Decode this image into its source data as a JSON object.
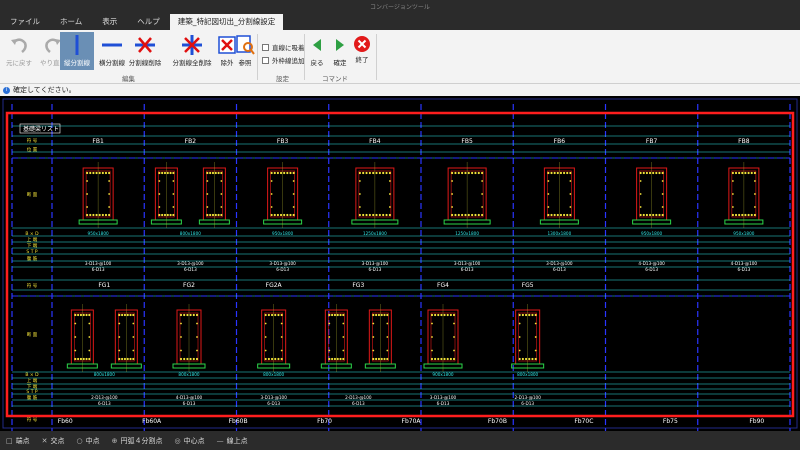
{
  "window": {
    "app_title": "コンバージョンツール"
  },
  "menu": {
    "tabs": [
      "ファイル",
      "ホーム",
      "表示",
      "ヘルプ",
      "建築_特記図切出_分割線設定"
    ]
  },
  "ribbon": {
    "undo": "元に戻す",
    "redo": "やり直し",
    "vert_split": "縦分割線",
    "horz_split": "横分割線",
    "delete_split": "分割線削除",
    "delete_all_split": "分割線全削除",
    "exclude": "除外",
    "reference": "参照",
    "group_edit": "編集",
    "opt_snap": "直線に吸着",
    "opt_add_frame": "外枠線追加",
    "group_settings": "設定",
    "back": "戻る",
    "confirm": "確定",
    "finish": "終了",
    "group_command": "コマンド"
  },
  "message": "確定してください。",
  "drawing": {
    "title_tag": "基礎梁リスト",
    "row1_labels": [
      "FB1",
      "FB2",
      "FB3",
      "FB4",
      "FB5",
      "FB6",
      "FB7",
      "FB8"
    ],
    "row2_labels": [
      "FG1",
      "FG2",
      "FG2A",
      "FG3",
      "FG4",
      "FG5"
    ],
    "bottom_labels": [
      "Fb60",
      "Fb60A",
      "Fb60B",
      "Fb70",
      "Fb70A",
      "Fb70B",
      "Fb70C",
      "Fb75",
      "Fb90"
    ],
    "sizes_row1": [
      "950x1800",
      "800x1800",
      "950x1800",
      "1250x1800",
      "1250x1800",
      "1300x1800",
      "950x1800",
      "950x1800"
    ],
    "sizes_row2": [
      "800x1800",
      "800x1800",
      "800x1800",
      "",
      "900x1800",
      "800x1800"
    ],
    "stirrup_row1": [
      "3-D13-@100",
      "3-D13-@100",
      "3-D13-@100",
      "3-D13-@100",
      "3-D13-@100",
      "3-D13-@100",
      "4-D13-@100",
      "4-D13-@100"
    ],
    "stirrup_row2": [
      "2-D13-@100",
      "4-D13-@100",
      "3-D13-@100",
      "2-D13-@100",
      "3-D13-@100",
      "2-D13-@100"
    ],
    "waist_row1": [
      "6-D13",
      "6-D13",
      "6-D13",
      "6-D13",
      "6-D13",
      "6-D13",
      "6-D13",
      "6-D13"
    ],
    "waist_row2": [
      "6-D13",
      "6-D13",
      "6-D13",
      "6-D13",
      "6-D13",
      "6-D13"
    ],
    "row_headers_top": [
      "符 号",
      "位 置",
      "断 面",
      "B × D",
      "上 端",
      "下 端",
      "S T P",
      "腹 筋"
    ],
    "row_headers_bottom": [
      "符 号",
      "断 面",
      "B × D",
      "上 端",
      "下 端",
      "S T P",
      "腹 筋",
      "符 号"
    ]
  },
  "status": [
    {
      "sym": "□",
      "label": "端点"
    },
    {
      "sym": "✕",
      "label": "交点"
    },
    {
      "sym": "○",
      "label": "中点"
    },
    {
      "sym": "⊕",
      "label": "円弧４分割点"
    },
    {
      "sym": "◎",
      "label": "中心点"
    },
    {
      "sym": "—",
      "label": "線上点"
    }
  ],
  "colors": {
    "selection": "#ff1e1e",
    "grid": "#2a35ff",
    "text": "#ffffff",
    "cyan": "#2ee6e6",
    "yellow": "#f2e23a",
    "green": "#2bd64a",
    "rebar": "#e01818"
  }
}
